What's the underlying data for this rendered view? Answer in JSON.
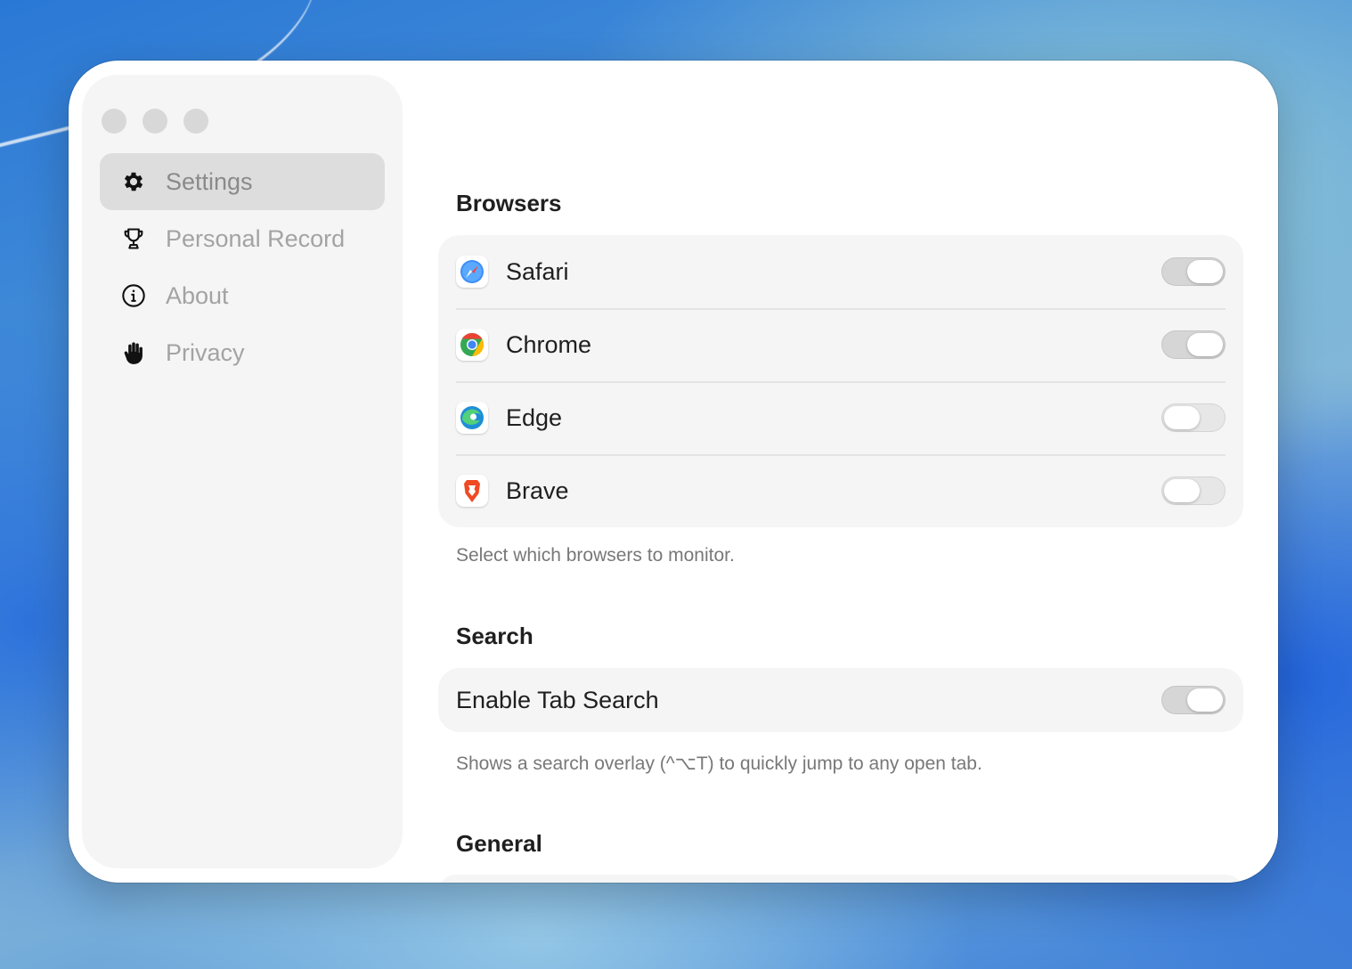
{
  "sidebar": {
    "items": [
      {
        "label": "Settings",
        "icon": "gear-icon",
        "active": true
      },
      {
        "label": "Personal Record",
        "icon": "trophy-icon",
        "active": false
      },
      {
        "label": "About",
        "icon": "info-circle-icon",
        "active": false
      },
      {
        "label": "Privacy",
        "icon": "hand-raised-icon",
        "active": false
      }
    ]
  },
  "browsers": {
    "title": "Browsers",
    "items": [
      {
        "label": "Safari",
        "icon": "safari-icon",
        "enabled": true
      },
      {
        "label": "Chrome",
        "icon": "chrome-icon",
        "enabled": true
      },
      {
        "label": "Edge",
        "icon": "edge-icon",
        "enabled": false
      },
      {
        "label": "Brave",
        "icon": "brave-icon",
        "enabled": false
      }
    ],
    "caption": "Select which browsers to monitor."
  },
  "search": {
    "title": "Search",
    "tab_search_label": "Enable Tab Search",
    "tab_search_enabled": true,
    "caption": "Shows a search overlay (^⌥T) to quickly jump to any open tab."
  },
  "general": {
    "title": "General"
  },
  "colors": {
    "toggle_on": "#d6d6d6",
    "toggle_off": "#e7e7e7",
    "sidebar_bg": "#f5f5f5",
    "active_item_bg": "#dddddd"
  }
}
